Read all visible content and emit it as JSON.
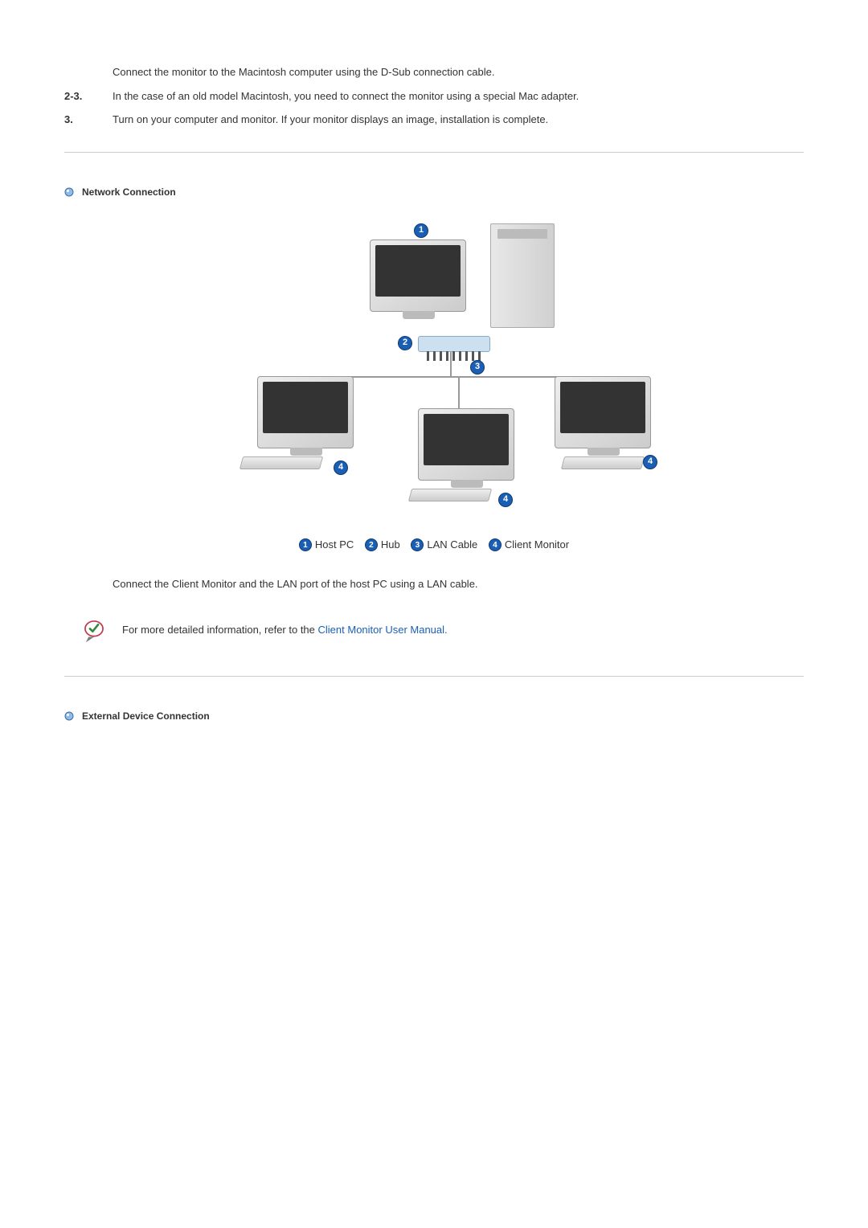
{
  "steps": {
    "intro": "Connect the monitor to the Macintosh computer using the D-Sub connection cable.",
    "s2_3_num": "2-3.",
    "s2_3_text": "In the case of an old model Macintosh, you need to connect the monitor using a special Mac adapter.",
    "s3_num": "3.",
    "s3_text": "Turn on your computer and monitor. If your monitor displays an image, installation is complete."
  },
  "sections": {
    "network_title": "Network Connection",
    "external_title": "External Device Connection"
  },
  "diagram": {
    "badge1": "1",
    "badge2": "2",
    "badge3": "3",
    "badge4": "4",
    "legend1": "Host PC",
    "legend2": "Hub",
    "legend3": "LAN Cable",
    "legend4": "Client Monitor"
  },
  "network_body": "Connect the Client Monitor and the LAN port of the host PC using a LAN cable.",
  "note": {
    "prefix": "For more detailed information, refer to the ",
    "link": "Client Monitor User Manual.",
    "suffix": ""
  }
}
